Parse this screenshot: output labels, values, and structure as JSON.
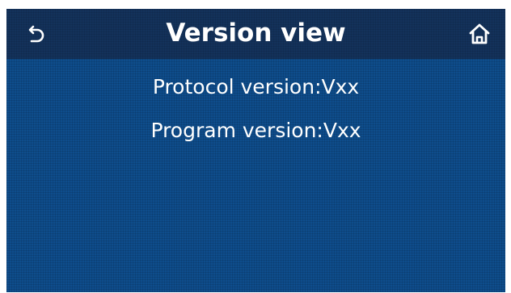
{
  "header": {
    "title": "Version view",
    "back_icon": "back-arrow-icon",
    "home_icon": "home-icon"
  },
  "main": {
    "protocol_version": "Protocol version:Vxx",
    "program_version": "Program version:Vxx"
  },
  "colors": {
    "screen_background": "#0e4d8c",
    "header_background": "#13325b",
    "text": "#ffffff"
  }
}
